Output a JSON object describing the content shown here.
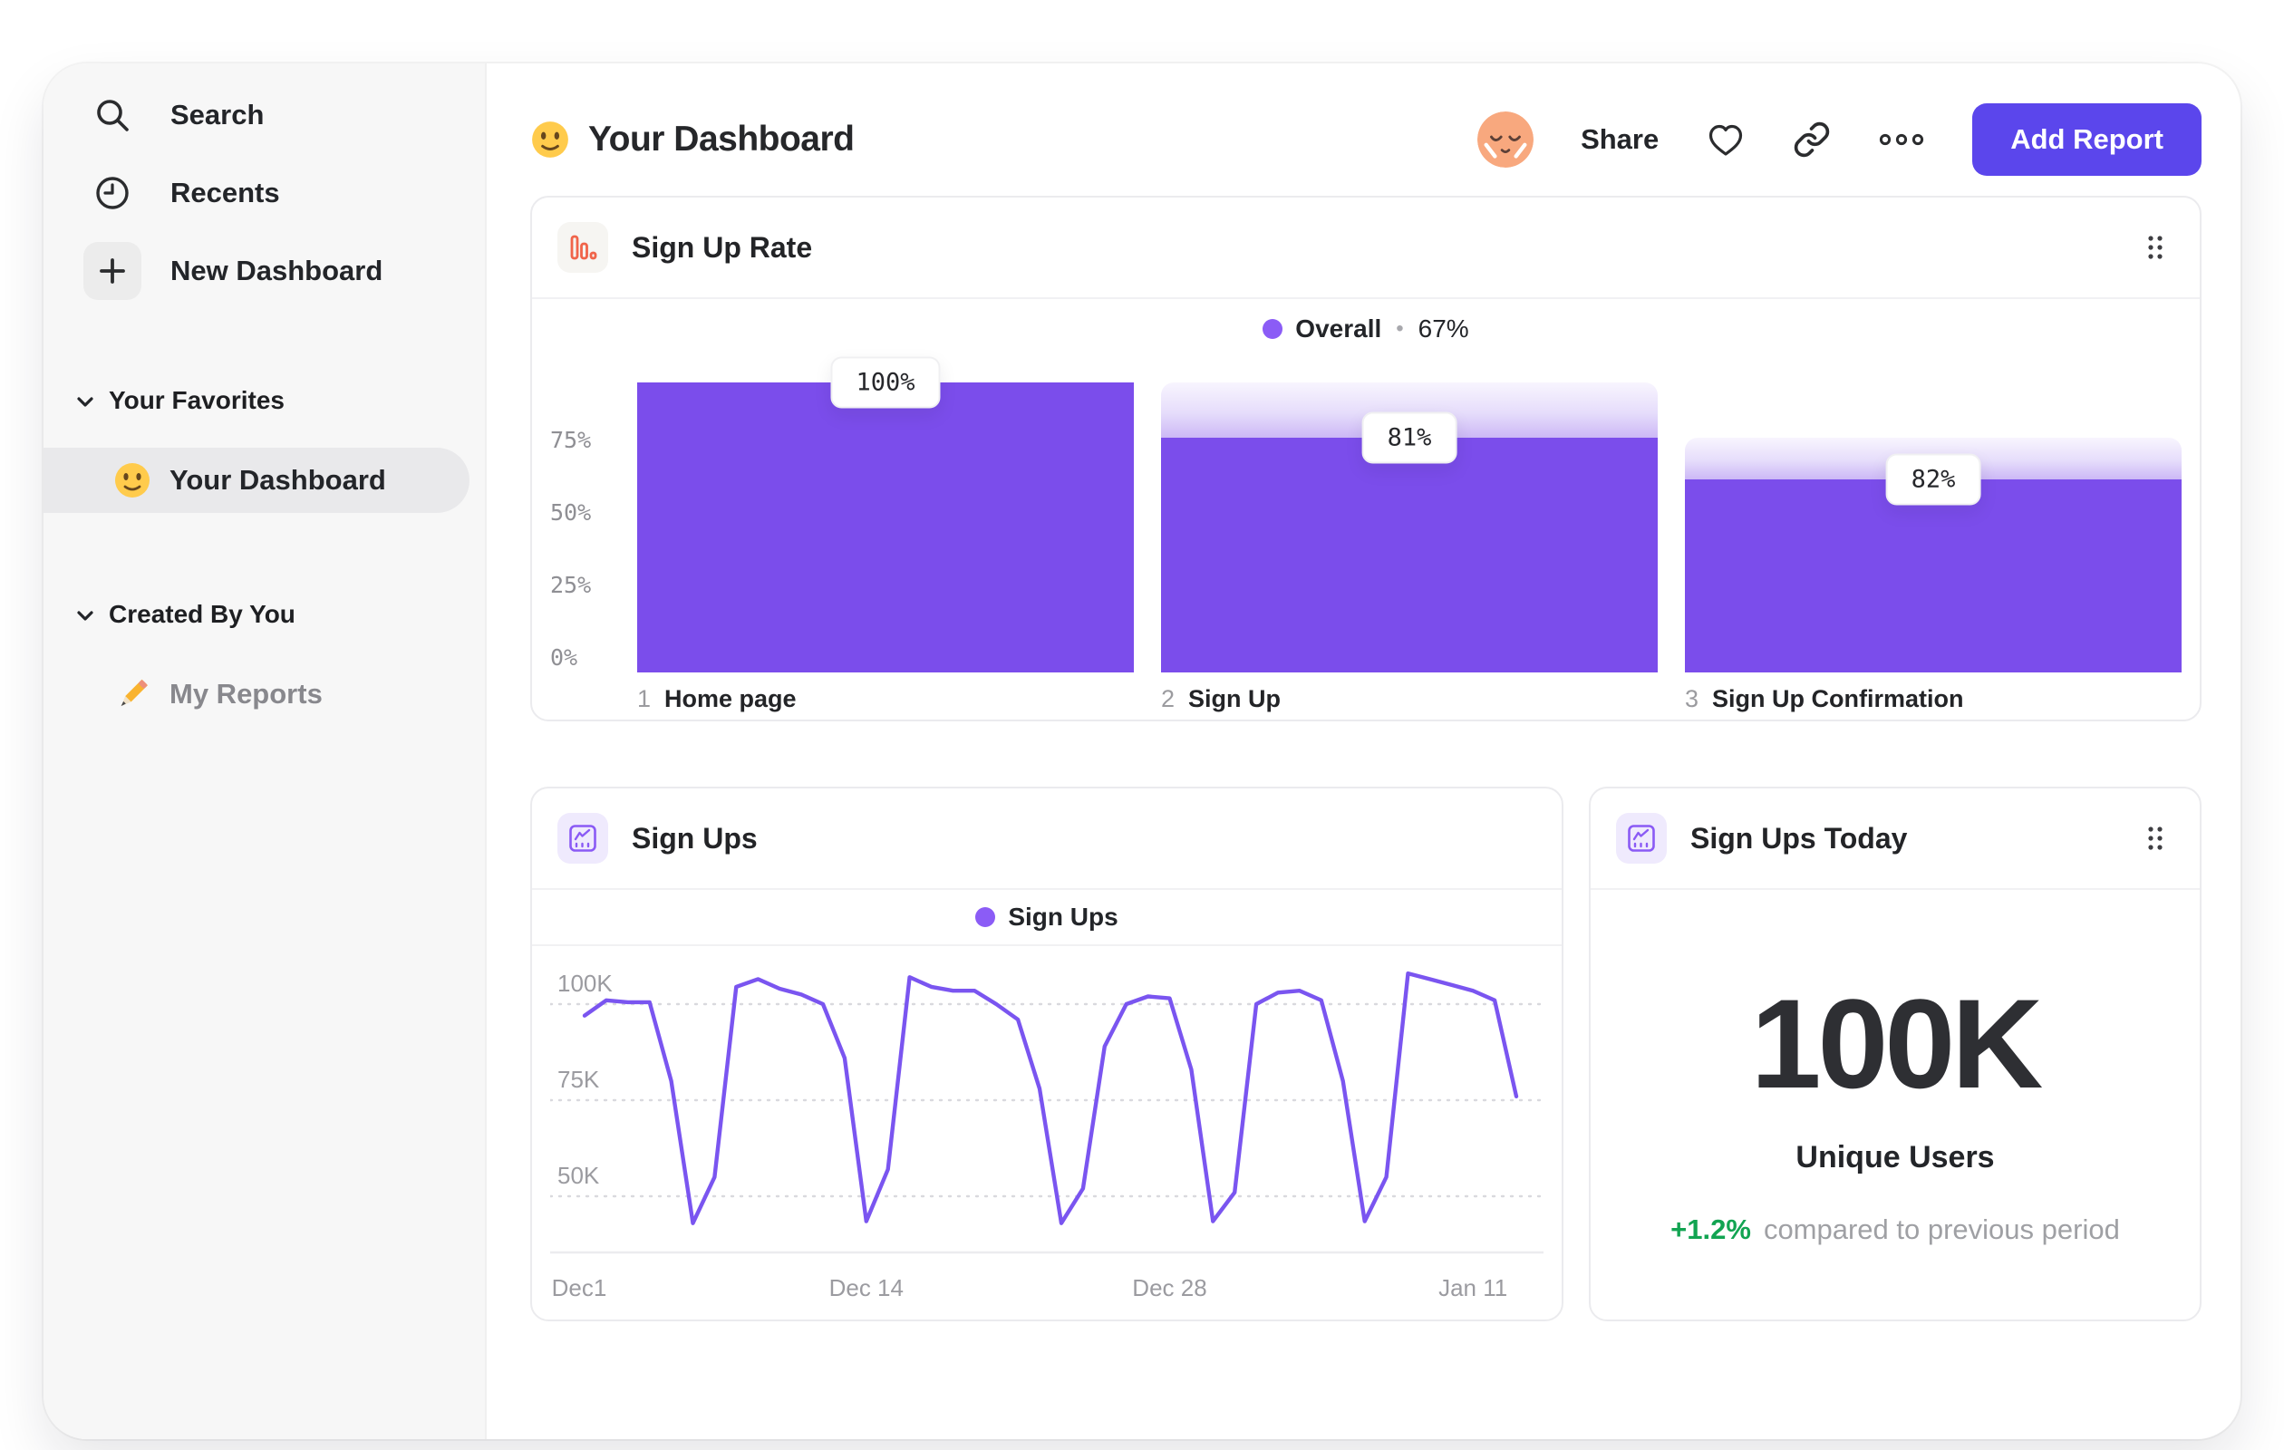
{
  "sidebar": {
    "nav_items": [
      {
        "icon": "search-icon",
        "label": "Search"
      },
      {
        "icon": "clock-icon",
        "label": "Recents"
      },
      {
        "icon": "plus-icon",
        "label": "New Dashboard"
      }
    ],
    "sections": [
      {
        "title": "Your Favorites",
        "items": [
          {
            "icon": "slightly-smiling-face-emoji",
            "label": "Your Dashboard",
            "selected": true
          }
        ]
      },
      {
        "title": "Created By You",
        "items": [
          {
            "icon": "pencil-emoji",
            "label": "My Reports",
            "selected": false
          }
        ]
      }
    ]
  },
  "header": {
    "emoji_icon": "slightly-smiling-face-emoji",
    "title": "Your Dashboard",
    "avatar_icon": "relieved-face-avatar",
    "share_label": "Share",
    "actions": [
      "heart-icon",
      "link-icon",
      "ellipsis-icon"
    ],
    "add_report_label": "Add Report"
  },
  "cards": {
    "funnel": {
      "title": "Sign Up Rate",
      "legend": {
        "name": "Overall",
        "separator": "•",
        "value": "67%"
      }
    },
    "line": {
      "title": "Sign Ups",
      "legend": {
        "name": "Sign Ups"
      }
    },
    "today": {
      "title": "Sign Ups Today",
      "value": "100K",
      "label": "Unique Users",
      "delta": "+1.2%",
      "delta_suffix": "compared to previous period"
    }
  },
  "chart_data": [
    {
      "type": "bar",
      "subtype": "funnel",
      "title": "Sign Up Rate",
      "categories": [
        "Home page",
        "Sign Up",
        "Sign Up Confirmation"
      ],
      "step_indices": [
        "1",
        "2",
        "3"
      ],
      "values": [
        100,
        81,
        82
      ],
      "value_labels": [
        "100%",
        "81%",
        "82%"
      ],
      "overall_conversion": "67%",
      "y_ticks": [
        "75%",
        "50%",
        "25%",
        "0%"
      ],
      "y_tick_fracs": [
        0.75,
        0.5,
        0.25,
        0
      ],
      "ylim": [
        0,
        100
      ],
      "legend": "Overall",
      "bar_color": "#7b4deb",
      "fade_gradient": [
        "#f8f5fe",
        "#ccb8f6"
      ]
    },
    {
      "type": "line",
      "title": "Sign Ups",
      "series": [
        {
          "name": "Sign Ups",
          "values": [
            97,
            101,
            100.5,
            100.5,
            80,
            43,
            55,
            104.5,
            106.5,
            104,
            102.5,
            100,
            86,
            43.5,
            57,
            107,
            104.5,
            103.5,
            103.5,
            100,
            96,
            78,
            43,
            52,
            89,
            100,
            102,
            101.5,
            83,
            43.5,
            51,
            100,
            103,
            103.5,
            101,
            80,
            43.5,
            55,
            108,
            106.5,
            105,
            103.5,
            101,
            76
          ]
        }
      ],
      "x_ticks": [
        "Dec1",
        "Dec 14",
        "Dec 28",
        "Jan 11"
      ],
      "x_tick_indices": [
        0,
        13,
        27,
        41
      ],
      "y_ticks": [
        "100K",
        "75K",
        "50K"
      ],
      "y_tick_values": [
        100,
        75,
        50
      ],
      "ylim": [
        40,
        110
      ],
      "grid": "dashed-horizontal",
      "legend_position": "top-center",
      "line_color": "#7a55f0"
    }
  ],
  "colors": {
    "accent_purple": "#7b4deb",
    "line_purple": "#7a55f0",
    "legend_dot_purple": "#8b5cf6",
    "button_purple": "#5b46ec",
    "icon_orange": "#f0644a",
    "icon_purple": "#8a5af5",
    "positive_green": "#12a452",
    "sidebar_bg": "#f7f7f7",
    "selected_pill": "#e9e9eb"
  }
}
